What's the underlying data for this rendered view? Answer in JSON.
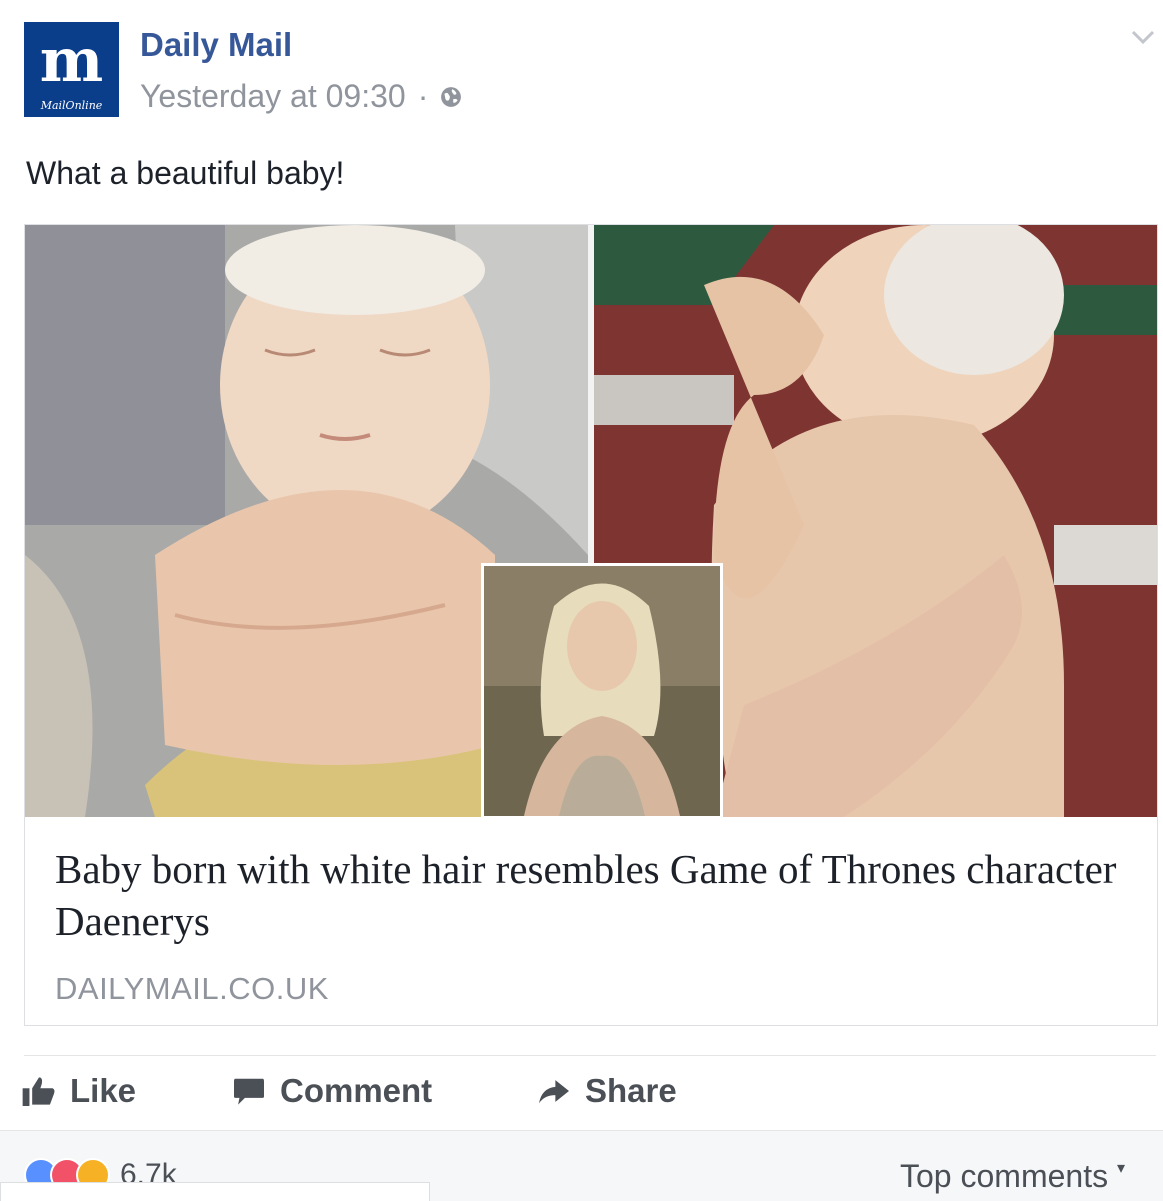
{
  "post": {
    "page_name": "Daily Mail",
    "logo_mark": "m",
    "logo_sub": "MailOnline",
    "timestamp": "Yesterday at 09:30",
    "separator": "·",
    "text": "What a beautiful baby!"
  },
  "link_card": {
    "title": "Baby born with white hair resembles Game of Thrones character Daenerys",
    "domain": "DAILYMAIL.CO.UK"
  },
  "actions": {
    "like_label": "Like",
    "comment_label": "Comment",
    "share_label": "Share"
  },
  "footer": {
    "reaction_count": "6.7k",
    "top_comments_label": "Top comments"
  },
  "icons": {
    "globe": "globe-icon",
    "chevron": "chevron-down-icon",
    "like": "thumbs-up-icon",
    "comment": "speech-bubble-icon",
    "share": "share-arrow-icon"
  },
  "colors": {
    "page_name": "#365899",
    "secondary_text": "#90949c",
    "logo_bg": "#0a3d8a",
    "like_reaction": "#5890ff",
    "love_reaction": "#f25268",
    "wow_reaction": "#f7b125"
  }
}
